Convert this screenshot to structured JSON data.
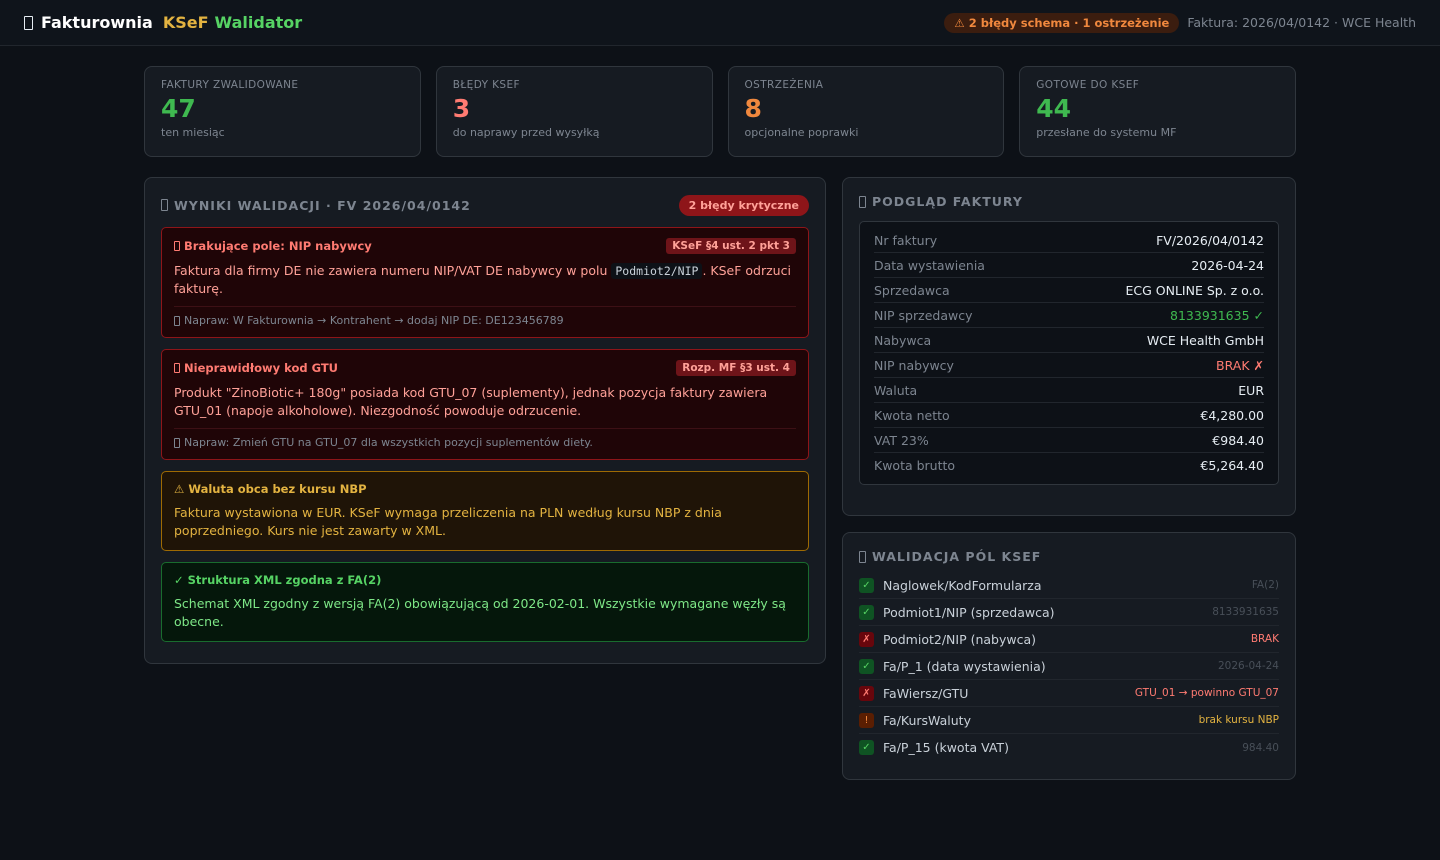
{
  "header": {
    "app_name": "Fakturownia",
    "ksef_word": "KSeF",
    "validator_word": "Walidator",
    "alert": "⚠ 2 błędy schema · 1 ostrzeżenie",
    "invoice_ref": "Faktura: 2026/04/0142 · WCE Health"
  },
  "stats": [
    {
      "label": "FAKTURY ZWALIDOWANE",
      "value": "47",
      "sub": "ten miesiąc",
      "color": "#3fb950"
    },
    {
      "label": "BŁĘDY KSEF",
      "value": "3",
      "sub": "do naprawy przed wysyłką",
      "color": "#ff7b72"
    },
    {
      "label": "OSTRZEŻENIA",
      "value": "8",
      "sub": "opcjonalne poprawki",
      "color": "#f0883e"
    },
    {
      "label": "GOTOWE DO KSEF",
      "value": "44",
      "sub": "przesłane do systemu MF",
      "color": "#3fb950"
    }
  ],
  "validation": {
    "title": "WYNIKI WALIDACJI · FV 2026/04/0142",
    "critical_badge": "2 błędy krytyczne",
    "issues": [
      {
        "title": "Brakujące pole: NIP nabywcy",
        "tag": "KSeF §4 ust. 2 pkt 3",
        "body_pre": "Faktura dla firmy DE nie zawiera numeru NIP/VAT DE nabywcy w polu",
        "body_code": "Podmiot2/NIP",
        "body_post": ". KSeF odrzuci fakturę.",
        "fix": "Napraw: W Fakturownia → Kontrahent → dodaj NIP DE: DE123456789"
      },
      {
        "title": "Nieprawidłowy kod GTU",
        "tag": "Rozp. MF §3 ust. 4",
        "body": "Produkt \"ZinoBiotic+ 180g\" posiada kod GTU_07 (suplementy), jednak pozycja faktury zawiera GTU_01 (napoje alkoholowe). Niezgodność powoduje odrzucenie.",
        "fix": "Napraw: Zmień GTU na GTU_07 dla wszystkich pozycji suplementów diety."
      },
      {
        "title": "⚠ Waluta obca bez kursu NBP",
        "body": "Faktura wystawiona w EUR. KSeF wymaga przeliczenia na PLN według kursu NBP z dnia poprzedniego. Kurs nie jest zawarty w XML."
      },
      {
        "title": "✓ Struktura XML zgodna z FA(2)",
        "body": "Schemat XML zgodny z wersją FA(2) obowiązującą od 2026-02-01. Wszystkie wymagane węzły są obecne."
      }
    ]
  },
  "preview": {
    "title": "PODGLĄD FAKTURY",
    "rows": [
      {
        "k": "Nr faktury",
        "v": "FV/2026/04/0142"
      },
      {
        "k": "Data wystawienia",
        "v": "2026-04-24"
      },
      {
        "k": "Sprzedawca",
        "v": "ECG ONLINE Sp. z o.o."
      },
      {
        "k": "NIP sprzedawcy",
        "v": "8133931635 ✓"
      },
      {
        "k": "Nabywca",
        "v": "WCE Health GmbH"
      },
      {
        "k": "NIP nabywcy",
        "v": "BRAK ✗"
      },
      {
        "k": "Waluta",
        "v": "EUR"
      },
      {
        "k": "Kwota netto",
        "v": "€4,280.00"
      },
      {
        "k": "VAT 23%",
        "v": "€984.40"
      },
      {
        "k": "Kwota brutto",
        "v": "€5,264.40"
      }
    ]
  },
  "fields": {
    "title": "WALIDACJA PÓL KSEF",
    "rows": [
      {
        "mark": "✓",
        "name": "Naglowek/KodFormularza",
        "val": "FA(2)"
      },
      {
        "mark": "✓",
        "name": "Podmiot1/NIP (sprzedawca)",
        "val": "8133931635"
      },
      {
        "mark": "✗",
        "name": "Podmiot2/NIP (nabywca)",
        "val": "BRAK"
      },
      {
        "mark": "✓",
        "name": "Fa/P_1 (data wystawienia)",
        "val": "2026-04-24"
      },
      {
        "mark": "✗",
        "name": "FaWiersz/GTU",
        "val": "GTU_01 → powinno GTU_07"
      },
      {
        "mark": "!",
        "name": "Fa/KursWaluty",
        "val": "brak kursu NBP"
      },
      {
        "mark": "✓",
        "name": "Fa/P_15 (kwota VAT)",
        "val": "984.40"
      }
    ]
  }
}
